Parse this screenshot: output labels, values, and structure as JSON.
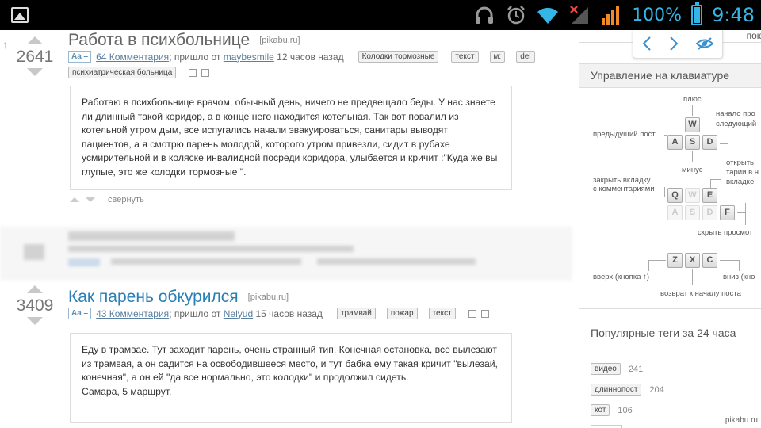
{
  "statusbar": {
    "battery_pct": "100%",
    "time": "9:48",
    "icons": [
      "image-icon",
      "headphones-icon",
      "alarm-icon",
      "wifi-icon",
      "signal-off-icon",
      "signal-icon",
      "battery-icon"
    ]
  },
  "nav": {
    "top_link": "пок",
    "prev_icon": "chevron-left-icon",
    "next_icon": "chevron-right-icon",
    "hide_icon": "eye-hide-icon"
  },
  "posts": [
    {
      "rating": "2641",
      "title": "Работа в психбольнице",
      "source": "[pikabu.ru]",
      "aa": "Aa –",
      "comments": "64 Комментария",
      "sent_by": "; пришло от",
      "author": "maybesmile",
      "time": "12 часов назад",
      "tags": [
        "Колодки тормозные",
        "текст",
        "м:",
        "del",
        "психиатрическая больница"
      ],
      "text": "Работаю в психбольнице врачом, обычный день, ничего не предвещало беды. У нас знаете ли длинный такой коридор, а в конце него находится котельная. Так вот повалил из котельной утром дым, все испугались начали эвакуироваться, санитары выводят пациентов, а я смотрю парень молодой, которого утром привезли, сидит в рубахе усмирительной и в коляске инвалидной посреди коридора, улыбается и кричит :\"Куда же вы глупые, это же колодки тормозные \".",
      "collapse": "свернуть"
    },
    {
      "rating": "3409",
      "title": "Как парень обкурился",
      "source": "[pikabu.ru]",
      "aa": "Aa –",
      "comments": "43 Комментария",
      "sent_by": "; пришло от",
      "author": "Nelyud",
      "time": "15 часов назад",
      "tags": [
        "трамвай",
        "пожар",
        "текст"
      ],
      "text": "Еду в трамвае. Тут заходит парень, очень странный тип. Конечная остановка, все вылезают из трамвая, а он садится на освободившееся место, и тут бабка ему такая кричит \"вылезай, конечная\", а он ей \"да все нормально, это колодки\" и продолжил сидеть.",
      "text2": "Самара, 5 маршрут."
    }
  ],
  "keyboard": {
    "title": "Управление на клавиатуре",
    "labels": {
      "plus": "плюс",
      "prev_post": "предыдущий пост",
      "start_next_1": "начало про",
      "start_next_2": "следующий",
      "minus": "минус",
      "close_tab_1": "закрыть вкладку",
      "close_tab_2": "с комментариями",
      "open_1": "открыть",
      "open_2": "тарии в н",
      "open_3": "вкладке",
      "hide_view": "скрыть просмот",
      "up": "вверх (кнопка ↑)",
      "down": "вниз (кно",
      "back_start": "возврат к началу поста"
    },
    "keys": {
      "w": "W",
      "a": "A",
      "s": "S",
      "d": "D",
      "q": "Q",
      "w2": "W",
      "e": "E",
      "a2": "A",
      "s2": "S",
      "d2": "D",
      "f": "F",
      "z": "Z",
      "x": "X",
      "c": "C"
    }
  },
  "popular": {
    "title": "Популярные теги за 24 часа",
    "tags": [
      {
        "name": "видео",
        "count": "241"
      },
      {
        "name": "длиннопост",
        "count": "204"
      },
      {
        "name": "кот",
        "count": "106"
      }
    ]
  },
  "watermark": "pikabu.ru",
  "colors": {
    "statusbar_bg": "#000000",
    "status_accent": "#33b5e5",
    "title_blue": "#2a7fb5",
    "title_gray": "#666666"
  }
}
